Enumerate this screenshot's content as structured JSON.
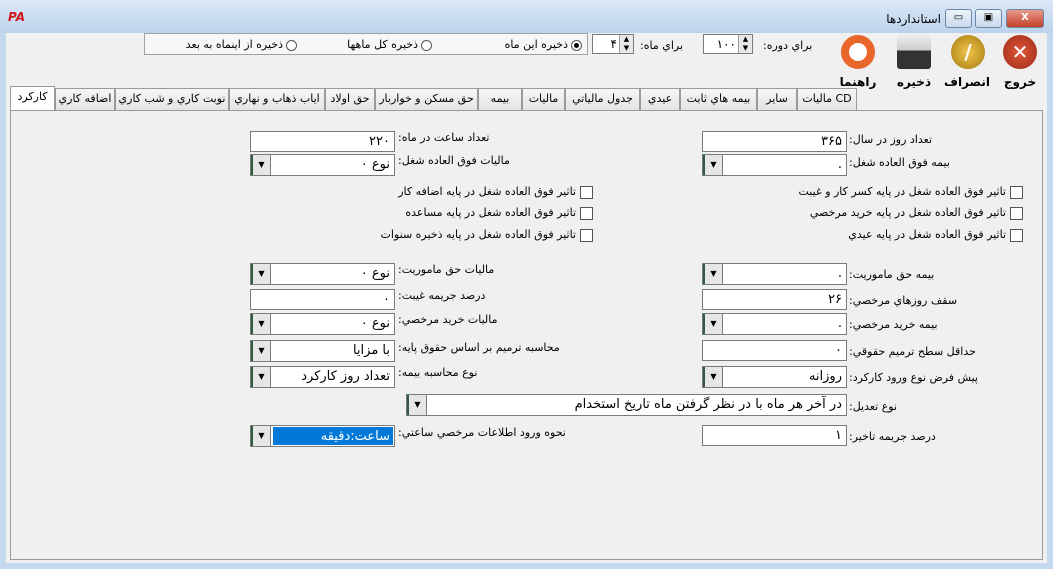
{
  "window": {
    "title": "استانداردها",
    "logo": "PA",
    "min": "▭",
    "max": "▣",
    "close": "X"
  },
  "toolbar": {
    "exit": "خروج",
    "cancel": "انصراف",
    "save": "ذخیره",
    "help": "راهنما"
  },
  "period": {
    "label": "براي دوره:",
    "value": "۱۰۰"
  },
  "month": {
    "label": "براي ماه:",
    "value": "۴"
  },
  "save_options": [
    {
      "label": "ذخیره این ماه",
      "selected": true
    },
    {
      "label": "ذخیره کل ماهها",
      "selected": false
    },
    {
      "label": "ذخیره از اینماه به بعد",
      "selected": false
    }
  ],
  "tabs": [
    "CD مالیات",
    "سایر",
    "بیمه هاي ثابت",
    "عیدي",
    "جدول مالیاتي",
    "مالیات",
    "بیمه",
    "حق مسکن و خواربار",
    "حق اولاد",
    "اياب ذهاب و نهاري",
    "نوبت کاري و شب کاري",
    "اضافه کاري",
    "کارکرد"
  ],
  "active_tab": "کارکرد",
  "form": {
    "days_per_year": {
      "label": "تعداد روز در سال:",
      "value": "۳۶۵"
    },
    "hours_per_month": {
      "label": "تعداد ساعت در ماه:",
      "value": "۲۲۰"
    },
    "overtime_insurance": {
      "label": "بیمه فوق العاده شغل:",
      "value": "."
    },
    "overtime_tax": {
      "label": "مالیات فوق العاده شغل:",
      "value": "نوع ۰"
    },
    "checks_right": [
      "تاثیر فوق العاده شغل در پایه کسر کار و غیبت",
      "تاثیر فوق العاده شغل در پایه خرید مرخصي",
      "تاثیر فوق العاده شغل در پایه عیدي"
    ],
    "checks_left": [
      "تاثیر فوق العاده شغل در پایه اضافه کار",
      "تاثیر فوق العاده شغل در پایه مساعده",
      "تاثیر فوق العاده شغل در پایه ذخیره سنوات"
    ],
    "mission_insurance": {
      "label": "بیمه حق ماموریت:",
      "value": "."
    },
    "mission_tax": {
      "label": "مالیات حق ماموریت:",
      "value": "نوع ۰"
    },
    "leave_cap": {
      "label": "سقف روزهاي مرخصي:",
      "value": "۲۶"
    },
    "absence_penalty": {
      "label": "درصد جریمه غیبت:",
      "value": "۰"
    },
    "leave_buy_insurance": {
      "label": "بیمه خرید مرخصي:",
      "value": "."
    },
    "leave_buy_tax": {
      "label": "مالیات خرید مرخصي:",
      "value": "نوع ۰"
    },
    "min_salary_adjust": {
      "label": "حداقل سطح ترمیم حقوقي:",
      "value": "۰"
    },
    "adjust_base": {
      "label": "محاسبه ترمیم بر اساس حقوق پایه:",
      "value": "با مزایا"
    },
    "default_entry": {
      "label": "پیش فرض نوع ورود کارکرد:",
      "value": "روزانه"
    },
    "insurance_calc": {
      "label": "نوع محاسبه بیمه:",
      "value": "تعداد روز کارکرد"
    },
    "adjust_type": {
      "label": "نوع تعدیل:",
      "value": "در آخر هر ماه با در نظر گرفتن ماه تاریخ استخدام"
    },
    "delay_penalty": {
      "label": "درصد جریمه تاخیر:",
      "value": "۱"
    },
    "hourly_leave_entry": {
      "label": "نحوه ورود اطلاعات مرخصي ساعتي:",
      "value": "ساعت:دقیقه"
    }
  }
}
